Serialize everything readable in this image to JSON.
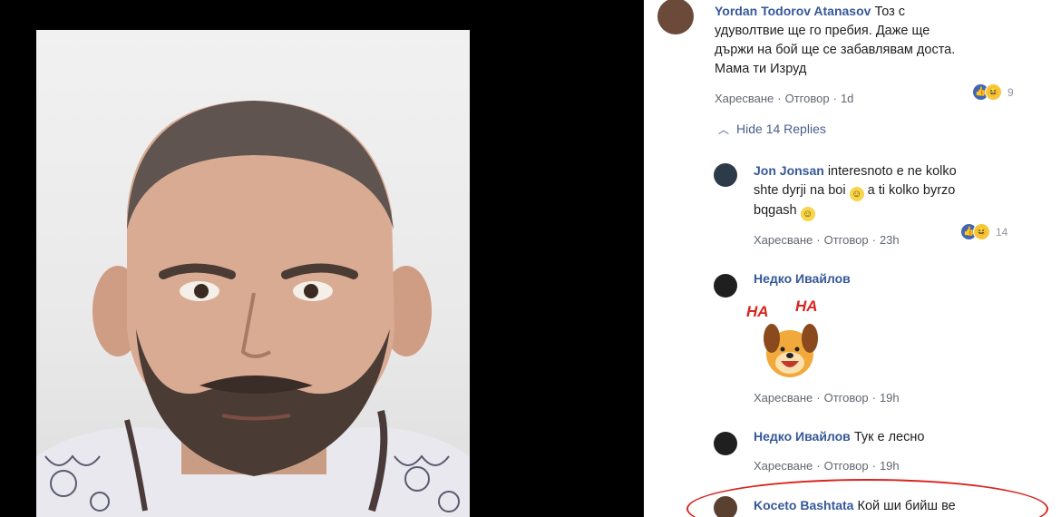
{
  "comments": [
    {
      "author": "Yordan Todorov Atanasov",
      "text_line1": "Тоз с",
      "text_line2": "удуволтвие ще го пребия. Даже ще",
      "text_line3": "държи на бой ще се забавлявам доста.",
      "text_line4": "Мама ти Изруд",
      "like": "Харесване",
      "reply": "Отговор",
      "time": "1d",
      "reaction_count": "9"
    }
  ],
  "hide_replies": "Hide 14 Replies",
  "replies": [
    {
      "author": "Jon Jonsan",
      "text_line1": "interesnoto e ne kolko",
      "text_line2a": "shte dyrji na boi",
      "text_line2b": "a ti kolko byrzo",
      "text_line3": "bqgash",
      "like": "Харесване",
      "reply": "Отговор",
      "time": "23h",
      "reaction_count": "14"
    },
    {
      "author": "Недко Ивайлов",
      "sticker_text_1": "HA",
      "sticker_text_2": "HA",
      "like": "Харесване",
      "reply": "Отговор",
      "time": "19h"
    },
    {
      "author": "Недко Ивайлов",
      "text": "Тук е лесно",
      "like": "Харесване",
      "reply": "Отговор",
      "time": "19h"
    },
    {
      "author": "Koceto Bashtata",
      "text": "Кой ши бийш ве"
    }
  ],
  "colors": {
    "author": "#365899",
    "highlight": "#d8261f",
    "like": "#4267b2"
  },
  "icons": [
    "chevron-up-icon",
    "like-reaction-icon",
    "haha-reaction-icon",
    "smile-emoji-icon"
  ]
}
